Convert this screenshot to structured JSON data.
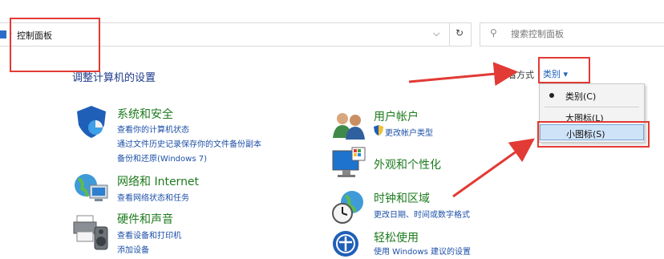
{
  "address_bar": {
    "separator": "›",
    "path": "控制面板",
    "dropdown_icon": "chevron-down-icon",
    "refresh_icon": "refresh-icon"
  },
  "search": {
    "placeholder": "搜索控制面板",
    "icon": "search-icon"
  },
  "heading": "调整计算机的设置",
  "view_by": {
    "label": "查看方式",
    "selected": "类别 ▾"
  },
  "view_menu": {
    "items": [
      {
        "label": "类别(C)",
        "selected": true
      },
      {
        "label": "大图标(L)",
        "selected": false
      },
      {
        "label": "小图标(S)",
        "selected": false
      }
    ]
  },
  "categories": {
    "system": {
      "title": "系统和安全",
      "links": [
        "查看你的计算机状态",
        "通过文件历史记录保存你的文件备份副本",
        "备份和还原(Windows 7)"
      ]
    },
    "network": {
      "title": "网络和 Internet",
      "links": [
        "查看网络状态和任务"
      ]
    },
    "hardware": {
      "title": "硬件和声音",
      "links": [
        "查看设备和打印机",
        "添加设备"
      ]
    },
    "accounts": {
      "title": "用户帐户",
      "links": [
        "更改帐户类型"
      ]
    },
    "appearance": {
      "title": "外观和个性化"
    },
    "clock": {
      "title": "时钟和区域",
      "links": [
        "更改日期、时间或数字格式"
      ]
    },
    "ease": {
      "title": "轻松使用",
      "links": [
        "使用 Windows 建议的设置"
      ]
    }
  },
  "colors": {
    "annotation_red": "#e23a34",
    "category_green": "#1e7a1e",
    "link_blue": "#1c4fa8",
    "heading_blue": "#1e3a8a"
  }
}
